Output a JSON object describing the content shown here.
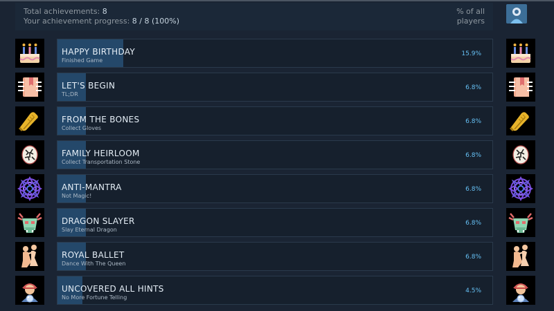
{
  "header": {
    "total_label": "Total achievements:",
    "total_value": "8",
    "progress_label": "Your achievement progress:",
    "progress_value": "8 / 8 (100%)",
    "pct_line1": "% of all",
    "pct_line2": "players"
  },
  "colors": {
    "page_bg": "#1a2433",
    "card_bg": "#16202d",
    "progress_fill": "#24486a",
    "percent_text": "#66c0f4"
  },
  "achievements": [
    {
      "title": "HAPPY BIRTHDAY",
      "description": "Finished Game",
      "percent": "15.9%",
      "global_fraction": 0.159,
      "icon": "birthday-cake-icon"
    },
    {
      "title": "LET'S BEGIN",
      "description": "TL;DR",
      "percent": "6.8%",
      "global_fraction": 0.068,
      "icon": "book-icon"
    },
    {
      "title": "FROM THE BONES",
      "description": "Collect Gloves",
      "percent": "6.8%",
      "global_fraction": 0.068,
      "icon": "gloves-icon"
    },
    {
      "title": "FAMILY HEIRLOOM",
      "description": "Collect Transportation Stone",
      "percent": "6.8%",
      "global_fraction": 0.068,
      "icon": "rune-stone-icon"
    },
    {
      "title": "ANTI-MANTRA",
      "description": "Not Magic!",
      "percent": "6.8%",
      "global_fraction": 0.068,
      "icon": "mandala-icon"
    },
    {
      "title": "DRAGON SLAYER",
      "description": "Slay Eternal Dragon",
      "percent": "6.8%",
      "global_fraction": 0.068,
      "icon": "dragon-mask-icon"
    },
    {
      "title": "ROYAL BALLET",
      "description": "Dance With The Queen",
      "percent": "6.8%",
      "global_fraction": 0.068,
      "icon": "dancing-couple-icon"
    },
    {
      "title": "UNCOVERED ALL HINTS",
      "description": "No More Fortune Telling",
      "percent": "4.5%",
      "global_fraction": 0.045,
      "icon": "fortune-teller-icon"
    }
  ]
}
